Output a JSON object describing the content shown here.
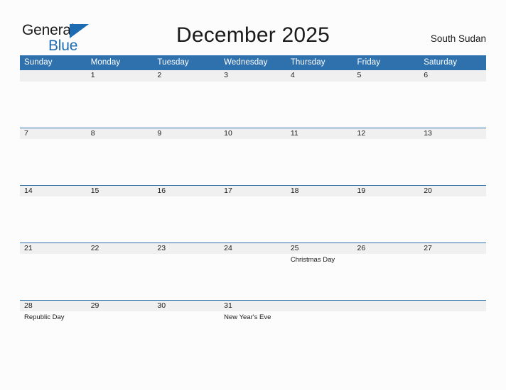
{
  "brand": {
    "word_one": "General",
    "word_two": "Blue",
    "accent_color": "#1d6cb1",
    "triangle_icon": "triangle-right-icon"
  },
  "header": {
    "title": "December 2025",
    "country": "South Sudan"
  },
  "theme": {
    "header_blue": "#2f71ad",
    "band_gray": "#f0f0f0",
    "page_background": "#fcfcfc",
    "text_color": "#1a1a1a"
  },
  "calendar": {
    "weekday_headers": [
      "Sunday",
      "Monday",
      "Tuesday",
      "Wednesday",
      "Thursday",
      "Friday",
      "Saturday"
    ],
    "weeks": [
      [
        {
          "date": "",
          "events": []
        },
        {
          "date": "1",
          "events": []
        },
        {
          "date": "2",
          "events": []
        },
        {
          "date": "3",
          "events": []
        },
        {
          "date": "4",
          "events": []
        },
        {
          "date": "5",
          "events": []
        },
        {
          "date": "6",
          "events": []
        }
      ],
      [
        {
          "date": "7",
          "events": []
        },
        {
          "date": "8",
          "events": []
        },
        {
          "date": "9",
          "events": []
        },
        {
          "date": "10",
          "events": []
        },
        {
          "date": "11",
          "events": []
        },
        {
          "date": "12",
          "events": []
        },
        {
          "date": "13",
          "events": []
        }
      ],
      [
        {
          "date": "14",
          "events": []
        },
        {
          "date": "15",
          "events": []
        },
        {
          "date": "16",
          "events": []
        },
        {
          "date": "17",
          "events": []
        },
        {
          "date": "18",
          "events": []
        },
        {
          "date": "19",
          "events": []
        },
        {
          "date": "20",
          "events": []
        }
      ],
      [
        {
          "date": "21",
          "events": []
        },
        {
          "date": "22",
          "events": []
        },
        {
          "date": "23",
          "events": []
        },
        {
          "date": "24",
          "events": []
        },
        {
          "date": "25",
          "events": [
            "Christmas Day"
          ]
        },
        {
          "date": "26",
          "events": []
        },
        {
          "date": "27",
          "events": []
        }
      ],
      [
        {
          "date": "28",
          "events": [
            "Republic Day"
          ]
        },
        {
          "date": "29",
          "events": []
        },
        {
          "date": "30",
          "events": []
        },
        {
          "date": "31",
          "events": [
            "New Year's Eve"
          ]
        },
        {
          "date": "",
          "events": []
        },
        {
          "date": "",
          "events": []
        },
        {
          "date": "",
          "events": []
        }
      ]
    ]
  }
}
